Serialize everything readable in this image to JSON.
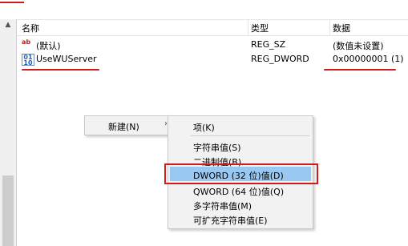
{
  "headers": {
    "name": "名称",
    "type": "类型",
    "data": "数据"
  },
  "rows": [
    {
      "icon": "string-value-icon",
      "name": "(默认)",
      "type": "REG_SZ",
      "data": "(数值未设置)"
    },
    {
      "icon": "binary-value-icon",
      "name": "UseWUServer",
      "type": "REG_DWORD",
      "data": "0x00000001 (1)"
    }
  ],
  "context_menu": {
    "new_label": "新建(N)",
    "new_arrow": "›"
  },
  "submenu": {
    "items": [
      "项(K)",
      "字符串值(S)",
      "二进制值(B)",
      "DWORD (32 位)值(D)",
      "QWORD (64 位)值(Q)",
      "多字符串值(M)",
      "可扩充字符串值(E)"
    ],
    "highlighted_index": 3
  },
  "icons": {
    "string_value": "ab",
    "binary_value": "011\n110"
  },
  "colors": {
    "annotation_red": "#d31a1a",
    "highlight_blue": "#99c9f3"
  }
}
